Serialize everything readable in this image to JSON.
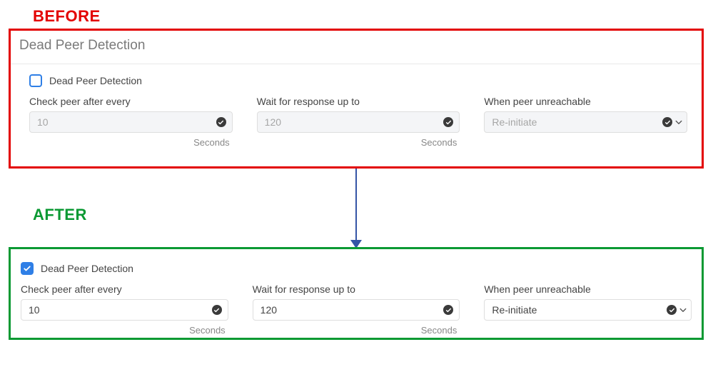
{
  "labels": {
    "before": "BEFORE",
    "after": "AFTER"
  },
  "before": {
    "section_title": "Dead Peer Detection",
    "switch_label": "Dead Peer Detection",
    "check_peer": {
      "label": "Check peer after every",
      "value": "10",
      "unit": "Seconds"
    },
    "wait_response": {
      "label": "Wait for response up to",
      "value": "120",
      "unit": "Seconds"
    },
    "when_unreachable": {
      "label": "When peer unreachable",
      "value": "Re-initiate"
    }
  },
  "after": {
    "switch_label": "Dead Peer Detection",
    "check_peer": {
      "label": "Check peer after every",
      "value": "10",
      "unit": "Seconds"
    },
    "wait_response": {
      "label": "Wait for response up to",
      "value": "120",
      "unit": "Seconds"
    },
    "when_unreachable": {
      "label": "When peer unreachable",
      "value": "Re-initiate"
    }
  }
}
